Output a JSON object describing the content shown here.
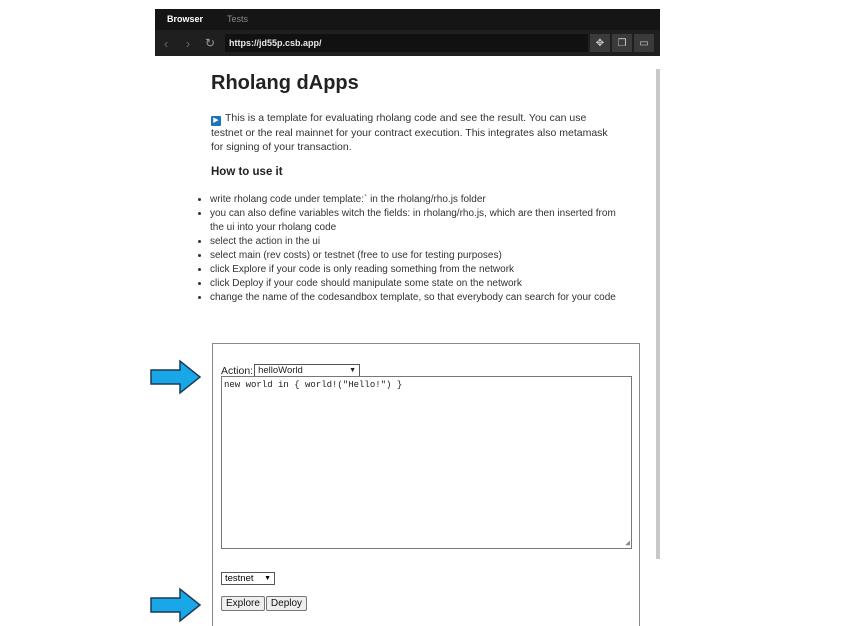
{
  "browser": {
    "tabs": [
      "Browser",
      "Tests"
    ],
    "url": "https://jd55p.csb.app/",
    "icons": [
      "back-icon",
      "forward-icon",
      "refresh-icon",
      "extension-icon",
      "copy-icon",
      "windows-icon"
    ]
  },
  "page": {
    "title": "Rholang dApps",
    "intro": "This is a template for evaluating rholang code and see the result. You can use testnet or the real mainnet for your contract execution. This integrates also metamask for signing of your transaction.",
    "how_title": "How to use it",
    "steps": [
      "write rholang code under template:` in the rholang/rho.js folder",
      "you can also define variables witch the fields: in rholang/rho.js, which are then inserted from the ui into your rholang code",
      "select the action in the ui",
      "select main (rev costs) or testnet (free to use for testing purposes)",
      "click Explore if your code is only reading something from the network",
      "click Deploy if your code should manipulate some state on the network",
      "change the name of the codesandbox template, so that everybody can search for your code"
    ]
  },
  "form": {
    "action_label": "Action:",
    "action_value": "helloWorld",
    "code": "new world in { world!(\"Hello!\") }",
    "network_value": "testnet",
    "explore_label": "Explore",
    "deploy_label": "Deploy"
  },
  "colors": {
    "arrow": "#1aa7e8",
    "arrow_outline": "#1a3a5a",
    "play": "#1e73be"
  }
}
